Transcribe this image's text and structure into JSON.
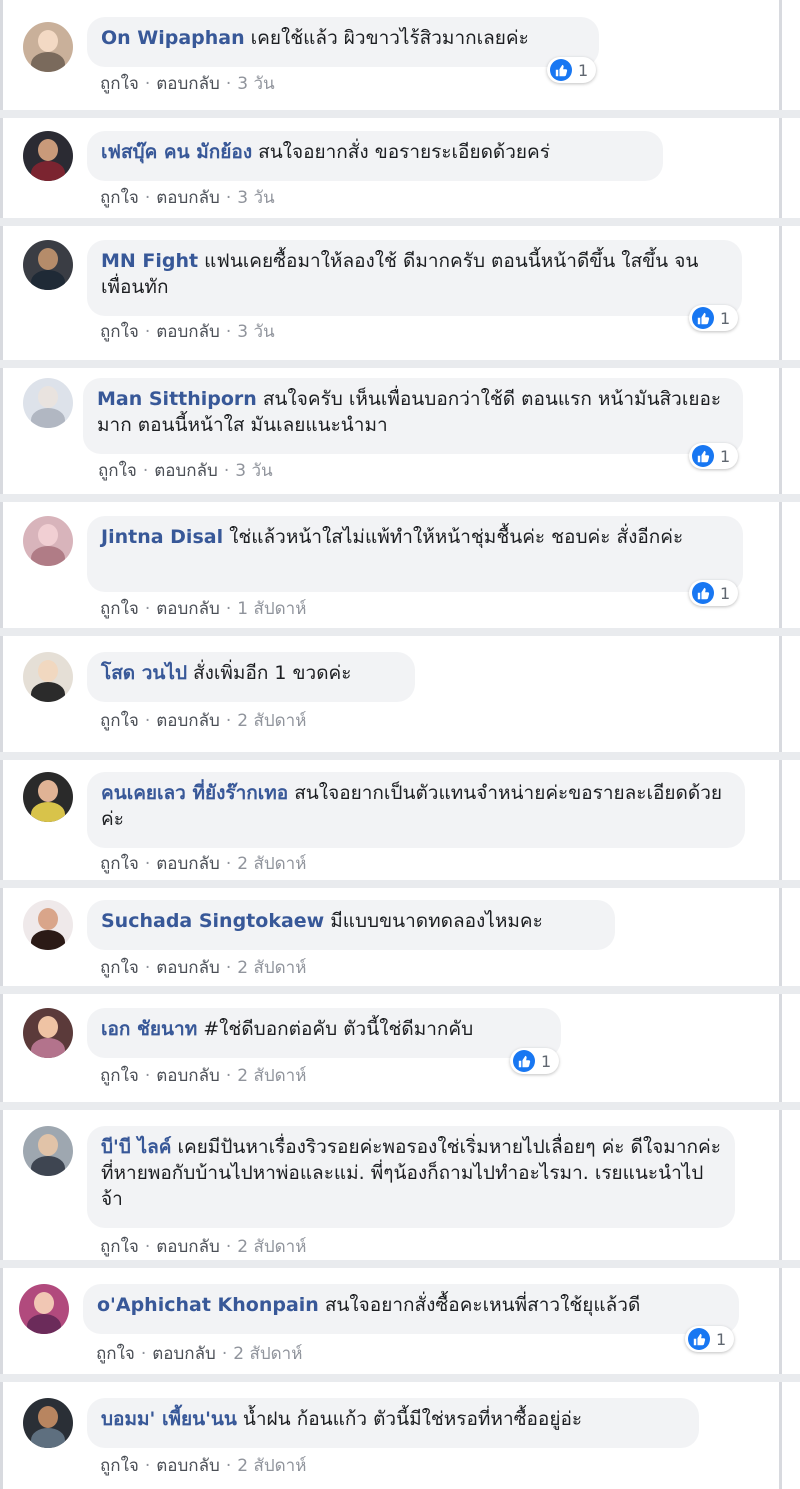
{
  "labels": {
    "like": "ถูกใจ",
    "reply": "ตอบกลับ",
    "separator": "·"
  },
  "comments": [
    {
      "author": "On Wipaphan",
      "text": "เคยใช้แล้ว ผิวขาวไร้สิวมากเลยค่ะ",
      "time": "3 วัน",
      "likes": "1"
    },
    {
      "author": "เฟสบุ๊ค คน มักย้อง",
      "text": "สนใจอยากสั่ง ขอรายระเอียดด้วยคร่",
      "time": "3 วัน"
    },
    {
      "author": "MN Fight",
      "text": "แฟนเคยซื้อมาให้ลองใช้ ดีมากครับ ตอนนี้หน้าดีขึ้น ใสขึ้น จนเพื่อนทัก",
      "time": "3 วัน",
      "likes": "1"
    },
    {
      "author": "Man Sitthiporn",
      "text": "สนใจครับ เห็นเพื่อนบอกว่าใช้ดี ตอนแรก หน้ามันสิวเยอะมาก ตอนนี้หน้าใส มันเลยแนะนำมา",
      "time": "3 วัน",
      "likes": "1"
    },
    {
      "author": "Jintna Disal",
      "text": "ใช่แล้วหน้าใสไม่แพ้ทำให้หน้าชุ่มชื้นค่ะ ชอบค่ะ สั่งอีกค่ะ",
      "time": "1 สัปดาห์",
      "likes": "1"
    },
    {
      "author": "โสด วนไป",
      "text": "สั่งเพิ่มอีก 1 ขวดค่ะ",
      "time": "2 สัปดาห์"
    },
    {
      "author": "คนเคยเลว ที่ยังร๊ากเทอ",
      "text": "สนใจอยากเป็นตัวแทนจำหน่ายค่ะขอรายละเอียดด้วยค่ะ",
      "time": "2 สัปดาห์"
    },
    {
      "author": "Suchada Singtokaew",
      "text": "มีแบบขนาดทดลองไหมคะ",
      "time": "2 สัปดาห์"
    },
    {
      "author": "เอก ชัยนาท",
      "text": "#ใช่ดีบอกต่อคับ ตัวนี้ใช่ดีมากคับ",
      "time": "2 สัปดาห์",
      "likes": "1"
    },
    {
      "author": "บี'บี ไลค์",
      "text": "เคยมีปันหาเรื่องริวรอยค่ะพอรองใช่เริ่มหายไปเลื่อยๆ ค่ะ ดีใจมากค่ะที่หายพอกับบ้านไปหาพ่อและแม่. พี่ๆน้องก็ถามไปทำอะไรมา. เรยแนะนำไปจ้า",
      "time": "2 สัปดาห์"
    },
    {
      "author": "o'Aphichat Khonpain",
      "text": "สนใจอยากสั่งซื้อคะเหนพี่สาวใช้ยุแล้วดี",
      "time": "2 สัปดาห์",
      "likes": "1"
    },
    {
      "author": "บอมม' เพี้ยน'นน",
      "text": "น้ำฝน ก้อนแก้ว ตัวนี้มีใช่หรอที่หาซื้ออยู่อ่ะ",
      "time": "2 สัปดาห์"
    }
  ],
  "colors": {
    "author": "#385898",
    "bubble": "#f2f3f5",
    "like_icon": "#1877f2",
    "action": "#4b4f56",
    "separator_band": "#e9ebee"
  },
  "icons": {
    "reaction": "like-thumb-icon"
  }
}
